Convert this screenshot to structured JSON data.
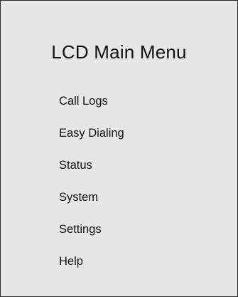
{
  "screen": {
    "title": "LCD Main Menu"
  },
  "menu": {
    "items": [
      {
        "label": "Call Logs"
      },
      {
        "label": "Easy Dialing"
      },
      {
        "label": "Status"
      },
      {
        "label": "System"
      },
      {
        "label": "Settings"
      },
      {
        "label": "Help"
      }
    ]
  },
  "colors": {
    "background": "#e6e6e6",
    "border": "#2a2a2a",
    "text": "#111111"
  }
}
